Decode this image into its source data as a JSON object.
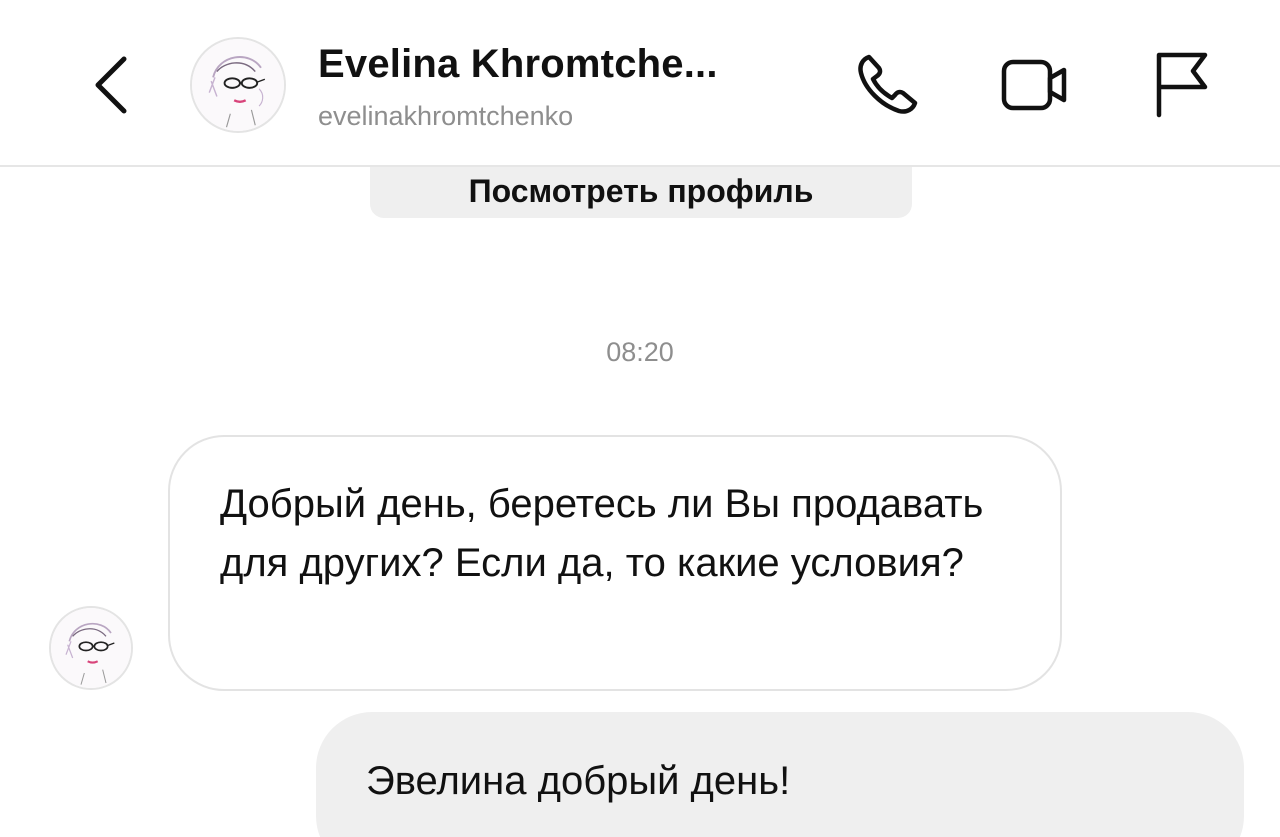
{
  "header": {
    "contact_name": "Evelina Khromtche...",
    "username": "evelinakhromtchenko"
  },
  "icons": {
    "back": "chevron-left-icon",
    "call": "phone-icon",
    "video": "video-camera-icon",
    "report": "flag-icon"
  },
  "chat": {
    "view_profile_label": "Посмотреть профиль",
    "timestamp": "08:20",
    "messages": [
      {
        "direction": "incoming",
        "text": "Добрый день, беретесь ли Вы продавать для других? Если да, то какие условия?"
      },
      {
        "direction": "outgoing",
        "text": "Эвелина добрый день!"
      }
    ]
  },
  "colors": {
    "background": "#ffffff",
    "outgoing_bubble": "#efefef",
    "incoming_border": "#e3e3e3",
    "secondary_text": "#8e8e8e",
    "primary_text": "#111111"
  }
}
